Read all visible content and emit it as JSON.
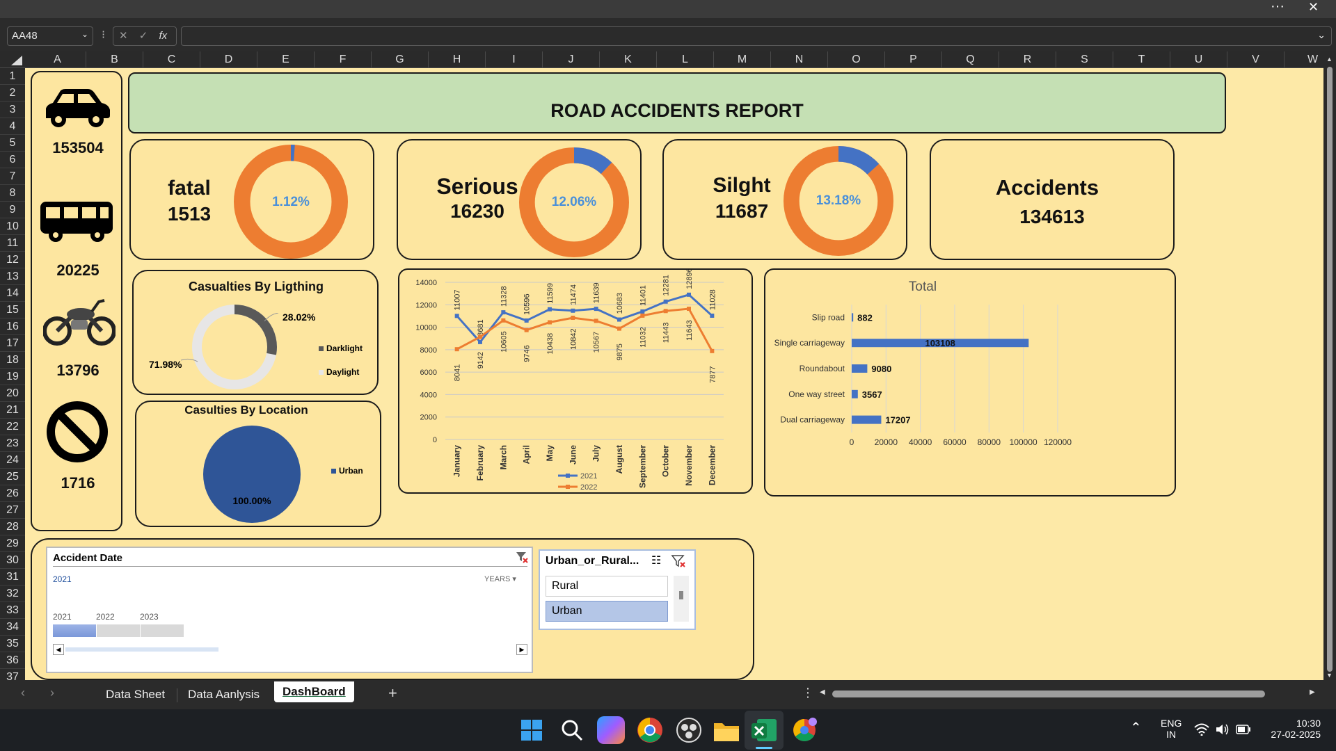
{
  "window": {
    "more_label": "···",
    "close_label": "✕"
  },
  "formula_bar": {
    "name_box": "AA48",
    "fx": "fx",
    "cancel": "✕",
    "confirm": "✓",
    "formula": ""
  },
  "columns": [
    "A",
    "B",
    "C",
    "D",
    "E",
    "F",
    "G",
    "H",
    "I",
    "J",
    "K",
    "L",
    "M",
    "N",
    "O",
    "P",
    "Q",
    "R",
    "S",
    "T",
    "U",
    "V",
    "W"
  ],
  "rows": [
    "1",
    "2",
    "3",
    "4",
    "5",
    "6",
    "7",
    "8",
    "9",
    "10",
    "11",
    "12",
    "13",
    "14",
    "15",
    "16",
    "17",
    "18",
    "19",
    "20",
    "21",
    "22",
    "23",
    "24",
    "25",
    "26",
    "27",
    "28",
    "29",
    "30",
    "31",
    "32",
    "33",
    "34",
    "35",
    "36",
    "37"
  ],
  "header": {
    "title": "ROAD ACCIDENTS REPORT"
  },
  "sidebar": {
    "items": [
      {
        "icon": "car-icon",
        "value": "153504"
      },
      {
        "icon": "bus-icon",
        "value": "20225"
      },
      {
        "icon": "motorcycle-icon",
        "value": "13796"
      },
      {
        "icon": "prohibited-icon",
        "value": "1716"
      }
    ]
  },
  "kpis": {
    "fatal": {
      "label": "fatal",
      "value": "1513",
      "pct": "1.12%",
      "fraction": 0.0112
    },
    "serious": {
      "label": "Serious",
      "value": "16230",
      "pct": "12.06%",
      "fraction": 0.1206
    },
    "slight": {
      "label": "Silght",
      "value": "11687",
      "pct": "13.18%",
      "fraction": 0.1318
    },
    "accidents": {
      "label": "Accidents",
      "value": "134613"
    }
  },
  "colors": {
    "orange": "#ed7d31",
    "blue": "#4472c4",
    "darkgray": "#595959",
    "lightgray": "#e7e6e6",
    "navy": "#2f5597",
    "header_green": "#c5e0b4",
    "panel": "#fde6a0"
  },
  "lighting": {
    "title": "Casualties By Ligthing",
    "darklight_label": "Darklight",
    "daylight_label": "Daylight",
    "darklight_pct": "28.02%",
    "daylight_pct": "71.98%",
    "darklight_fraction": 0.2802
  },
  "location": {
    "title": "Casulties By Location",
    "urban_label": "Urban",
    "urban_pct": "100.00%"
  },
  "chart_data": [
    {
      "type": "line",
      "categories": [
        "January",
        "February",
        "March",
        "April",
        "May",
        "June",
        "July",
        "August",
        "September",
        "October",
        "November",
        "December"
      ],
      "series": [
        {
          "name": "2021",
          "values": [
            11007,
            8681,
            11328,
            10596,
            11599,
            11474,
            11639,
            10683,
            11401,
            12281,
            12896,
            11028
          ]
        },
        {
          "name": "2022",
          "values": [
            8041,
            9142,
            10605,
            9746,
            10438,
            10842,
            10567,
            9875,
            11032,
            11443,
            11643,
            7877
          ]
        }
      ],
      "yticks": [
        "0",
        "2000",
        "4000",
        "6000",
        "8000",
        "10000",
        "12000",
        "14000"
      ],
      "ylim": [
        0,
        14000
      ],
      "legend": "bottom"
    },
    {
      "type": "bar",
      "title": "Total",
      "categories": [
        "Slip road",
        "Single carriageway",
        "Roundabout",
        "One way street",
        "Dual carriageway"
      ],
      "values": [
        882,
        103108,
        9080,
        3567,
        17207
      ],
      "value_labels": [
        "882",
        "103108",
        "9080",
        "3567",
        "17207"
      ],
      "xticks": [
        "0",
        "20000",
        "40000",
        "60000",
        "80000",
        "100000",
        "120000"
      ],
      "xlim": [
        0,
        120000
      ]
    }
  ],
  "slicers": {
    "date": {
      "title": "Accident Date",
      "selected": "2021",
      "period": "YEARS",
      "years": [
        "2021",
        "2022",
        "2023"
      ]
    },
    "area": {
      "title": "Urban_or_Rural...",
      "options": [
        "Rural",
        "Urban"
      ]
    }
  },
  "tabs": {
    "items": [
      "Data Sheet",
      "Data Aanlysis",
      "DashBoard"
    ],
    "add": "+"
  },
  "taskbar": {
    "lang": "ENG",
    "region": "IN",
    "time": "10:30",
    "date": "27-02-2025"
  }
}
